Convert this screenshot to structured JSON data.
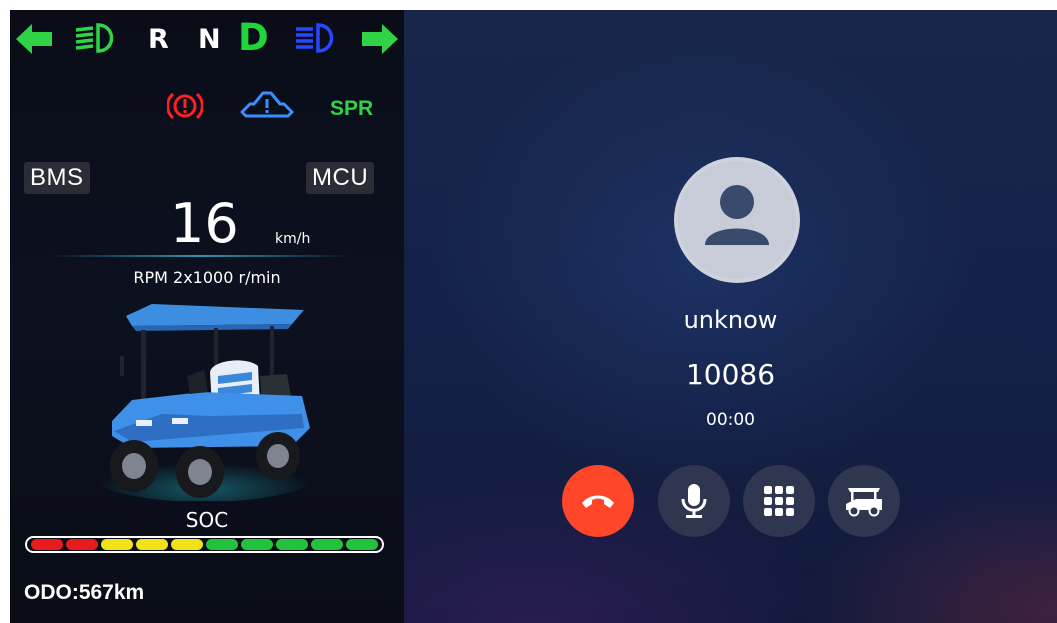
{
  "colors": {
    "turn_signal": "#2fd345",
    "low_beam": "#2fd345",
    "high_beam": "#2748ff",
    "parking_brake": "#ff2020",
    "fault_icon": "#3a8fff",
    "spr": "#2fd345",
    "gear_active": "#1fd63a",
    "hangup": "#ff4628"
  },
  "indicators": {
    "left_turn_icon": "arrow-left-icon",
    "low_beam_icon": "low-beam-icon",
    "high_beam_icon": "high-beam-icon",
    "right_turn_icon": "arrow-right-icon",
    "brake_icon": "parking-brake-icon",
    "fault_icon": "vehicle-fault-icon",
    "spr_label": "SPR"
  },
  "gears": {
    "r": "R",
    "n": "N",
    "d": "D"
  },
  "cluster": {
    "bms_label": "BMS",
    "mcu_label": "MCU",
    "speed_value": "16",
    "speed_unit": "km/h",
    "rpm_text": "RPM 2x1000 r/min",
    "soc_label": "SOC",
    "soc_segments": [
      "red",
      "red",
      "yellow",
      "yellow",
      "yellow",
      "green",
      "green",
      "green",
      "green",
      "green"
    ],
    "odo_text": "ODO:567km"
  },
  "call": {
    "name": "unknow",
    "number": "10086",
    "duration": "00:00",
    "buttons": [
      "hang-up",
      "microphone",
      "keypad",
      "cart"
    ]
  }
}
